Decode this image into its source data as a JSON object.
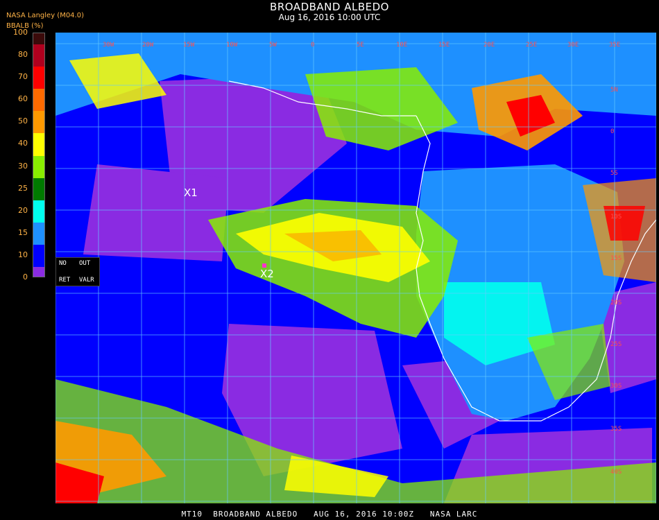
{
  "title": "BROADBAND ALBEDO",
  "subtitle": "Aug 16, 2016 10:00 UTC",
  "provider": "NASA Langley (M04.0)",
  "parameter": "BBALB (%)",
  "colorbar": {
    "ticks": [
      "100",
      "80",
      "70",
      "60",
      "50",
      "40",
      "30",
      "25",
      "20",
      "15",
      "10",
      "0"
    ],
    "colors": [
      "#3b0a0a",
      "#b0001e",
      "#ff0000",
      "#ff6a00",
      "#ff9900",
      "#ffff00",
      "#88ee00",
      "#007a00",
      "#00ffee",
      "#1e90ff",
      "#0000ff",
      "#8a2be2"
    ]
  },
  "legend": {
    "no": "NO",
    "out": "OUT",
    "ret": "RET",
    "valr": "VALR"
  },
  "markers": [
    {
      "label": "X1"
    },
    {
      "label": "X2"
    }
  ],
  "lon_labels": [
    "30W",
    "20W",
    "15W",
    "10W",
    "5W",
    "0",
    "5E",
    "10E",
    "15E",
    "20E",
    "25E",
    "30E",
    "35E"
  ],
  "lat_labels": [
    "5N",
    "0",
    "5S",
    "10S",
    "15S",
    "20S",
    "25S",
    "30S",
    "35S",
    "40S"
  ],
  "footer": "MT10  BROADBAND ALBEDO   AUG 16, 2016 10:00Z   NASA LARC"
}
